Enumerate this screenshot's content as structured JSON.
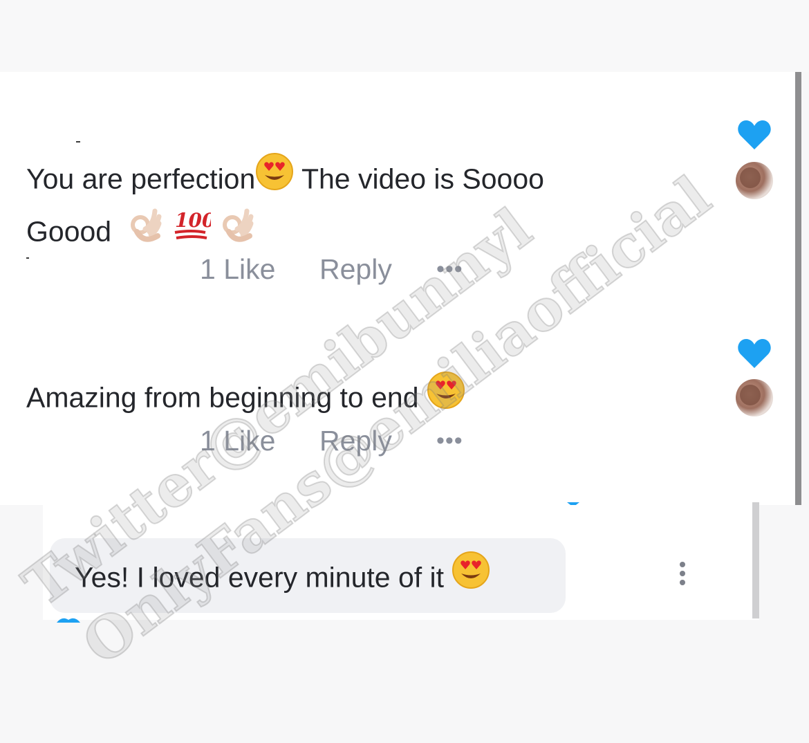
{
  "comments": [
    {
      "text": "You are perfection",
      "text_cont": " The video is Soooo",
      "text_line2": "Goood",
      "emojis": [
        "heart-eyes",
        "ok-hand",
        "hundred-points",
        "ok-hand"
      ],
      "likes": "1 Like",
      "reply": "Reply",
      "more": "•••"
    },
    {
      "text": "Amazing from beginning to end",
      "emojis": [
        "heart-eyes"
      ],
      "likes": "1 Like",
      "reply": "Reply",
      "more": "•••"
    }
  ],
  "reply_bubble": {
    "text": "Yes! I loved every minute of it",
    "emojis": [
      "heart-eyes"
    ]
  },
  "watermarks": [
    "Twitter@emibunnyl",
    "OnlyFans@emiliaofficial"
  ],
  "colors": {
    "heart": "#1da1f2",
    "action_text": "#8a8f9b",
    "bubble": "#f0f1f4"
  },
  "icons": [
    "heart-icon",
    "avatar",
    "more-icon",
    "kebab-icon"
  ]
}
